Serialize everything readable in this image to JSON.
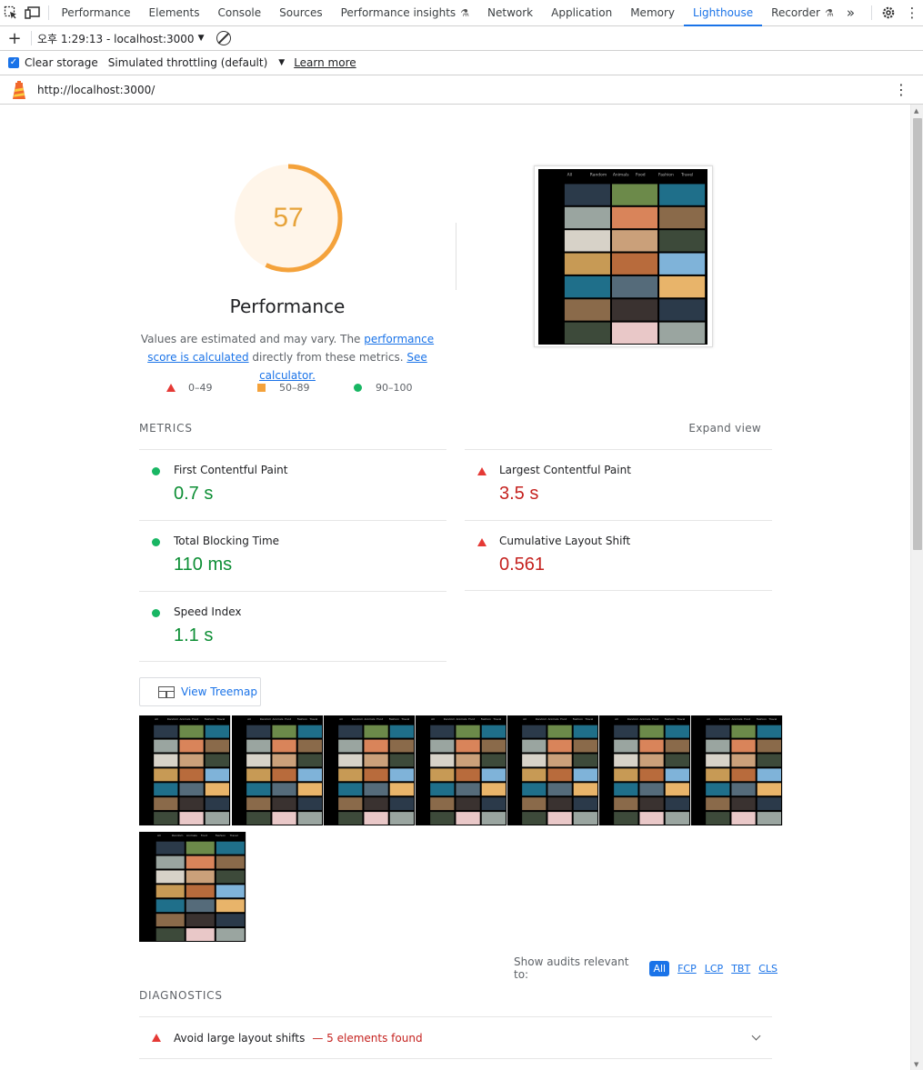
{
  "devtools": {
    "tabs": [
      {
        "label": "Performance",
        "experimental": false,
        "active": false
      },
      {
        "label": "Elements",
        "experimental": false,
        "active": false
      },
      {
        "label": "Console",
        "experimental": false,
        "active": false
      },
      {
        "label": "Sources",
        "experimental": false,
        "active": false
      },
      {
        "label": "Performance insights",
        "experimental": true,
        "active": false
      },
      {
        "label": "Network",
        "experimental": false,
        "active": false
      },
      {
        "label": "Application",
        "experimental": false,
        "active": false
      },
      {
        "label": "Memory",
        "experimental": false,
        "active": false
      },
      {
        "label": "Lighthouse",
        "experimental": false,
        "active": true
      },
      {
        "label": "Recorder",
        "experimental": true,
        "active": false
      }
    ],
    "overflow_label": "»"
  },
  "lighthouse_toolbar": {
    "report_label": "오후 1:29:13 - localhost:3000",
    "clear_storage_label": "Clear storage",
    "clear_storage_checked": true,
    "throttling_label": "Simulated throttling (default)",
    "learn_more_label": "Learn more"
  },
  "url": "http://localhost:3000/",
  "performance": {
    "score": "57",
    "score_fraction": 0.57,
    "score_color": "#f4a23b",
    "title": "Performance",
    "desc_1": "Values are estimated and may vary. The ",
    "desc_link_1": "performance score is calculated",
    "desc_2": " directly from these metrics. ",
    "desc_link_2": "See calculator."
  },
  "legend": [
    {
      "label": "0–49",
      "shape": "triangle",
      "color": "#e53935"
    },
    {
      "label": "50–89",
      "shape": "square",
      "color": "#f4a23b"
    },
    {
      "label": "90–100",
      "shape": "circle",
      "color": "#18b663"
    }
  ],
  "metrics": {
    "heading": "METRICS",
    "expand_label": "Expand view",
    "items": [
      {
        "label": "First Contentful Paint",
        "value": "0.7 s",
        "status": "pass"
      },
      {
        "label": "Largest Contentful Paint",
        "value": "3.5 s",
        "status": "fail"
      },
      {
        "label": "Total Blocking Time",
        "value": "110 ms",
        "status": "pass"
      },
      {
        "label": "Cumulative Layout Shift",
        "value": "0.561",
        "status": "fail"
      },
      {
        "label": "Speed Index",
        "value": "1.1 s",
        "status": "pass"
      }
    ]
  },
  "treemap_label": "View Treemap",
  "filter": {
    "label": "Show audits relevant to:",
    "chips": [
      "All",
      "FCP",
      "LCP",
      "TBT",
      "CLS"
    ]
  },
  "diagnostics": {
    "heading": "DIAGNOSTICS",
    "audits": [
      {
        "title": "Avoid large layout shifts",
        "display_value": "— 5 elements found"
      }
    ]
  },
  "screenshot_nav": [
    "All",
    "Random",
    "Animals",
    "Food",
    "Fashion",
    "Travel"
  ]
}
